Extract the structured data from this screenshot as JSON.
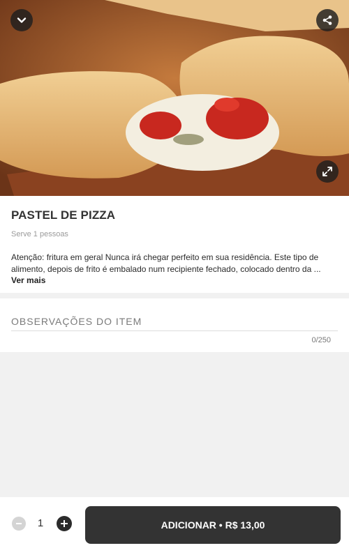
{
  "product": {
    "title": "PASTEL DE PIZZA",
    "serves": "Serve 1 pessoas",
    "description": "Atenção: fritura em geral Nunca irá chegar perfeito em sua residência. Este tipo de alimento, depois de frito é embalado num recipiente fechado, colocado dentro da ...",
    "more_label": "Ver mais",
    "image_icons": [
      "chevron-down-icon",
      "share-icon",
      "expand-icon"
    ]
  },
  "notes": {
    "label": "OBSERVAÇÕES DO ITEM",
    "counter": "0/250"
  },
  "footer": {
    "quantity": "1",
    "add_label": "ADICIONAR • R$ 13,00"
  },
  "colors": {
    "primary_button": "#333333",
    "background": "#f1f1f1"
  }
}
